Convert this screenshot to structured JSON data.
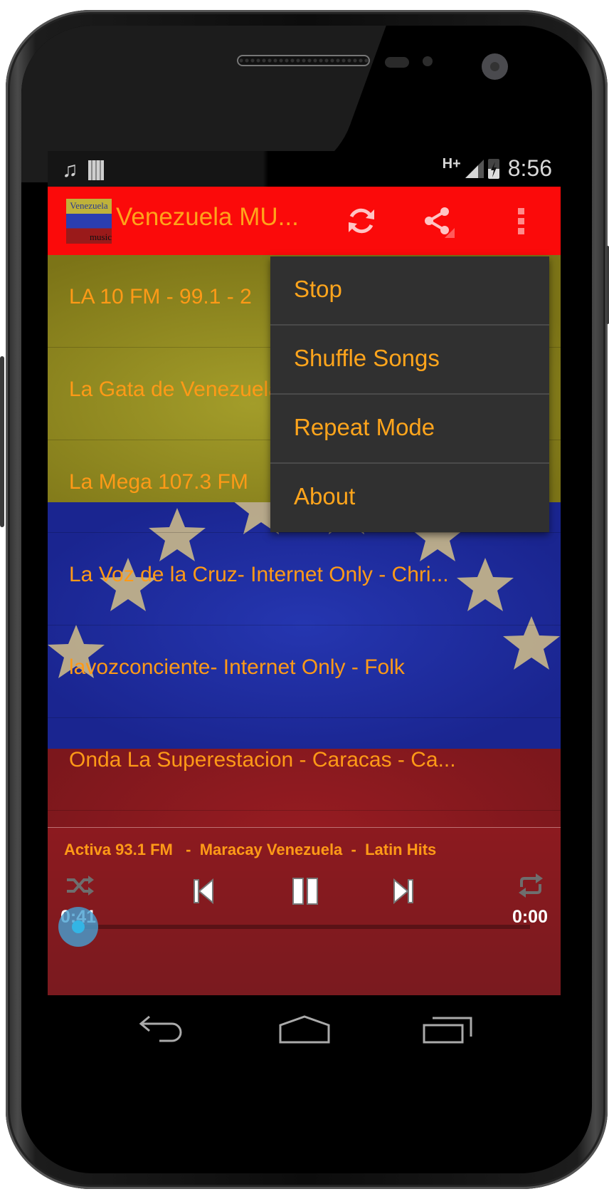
{
  "status_bar": {
    "left_icons": [
      "music-note-icon",
      "barcode-icon"
    ],
    "network": "H+",
    "time": "8:56"
  },
  "action_bar": {
    "app_icon": {
      "top_text": "Venezuela",
      "bottom_text": "music"
    },
    "title": "Venezuela MU...",
    "actions": [
      "refresh-icon",
      "share-icon",
      "overflow-menu-icon"
    ],
    "color": "#fb0a0a"
  },
  "stations": [
    {
      "label": "LA 10 FM - 99.1 - 2"
    },
    {
      "label": "La Gata de Venezuela"
    },
    {
      "label": "La Mega 107.3 FM"
    },
    {
      "label": "La Voz de la Cruz- Internet Only  - Chri..."
    },
    {
      "label": "lavozconciente- Internet Only  - Folk"
    },
    {
      "label": "Onda La Superestacion - Caracas - Ca..."
    }
  ],
  "overflow_menu": {
    "items": [
      {
        "label": "Stop"
      },
      {
        "label": "Shuffle Songs"
      },
      {
        "label": "Repeat Mode"
      },
      {
        "label": "About"
      }
    ]
  },
  "player": {
    "now_playing": "Activa 93.1 FM   -  Maracay Venezuela  -  Latin Hits",
    "elapsed": "0:41",
    "duration": "0:00",
    "progress_percent": 0,
    "controls": [
      "shuffle-icon",
      "previous-icon",
      "pause-icon",
      "next-icon",
      "repeat-icon"
    ]
  },
  "nav_bar": [
    "back-icon",
    "home-icon",
    "recent-apps-icon"
  ],
  "colors": {
    "accent_text": "#ff9a17",
    "menu_bg": "#303030",
    "flag_yellow": "#8f8a1f",
    "flag_blue": "#1f2d9c",
    "flag_red": "#8e1a1f",
    "seek_thumb": "#33b5e5"
  }
}
